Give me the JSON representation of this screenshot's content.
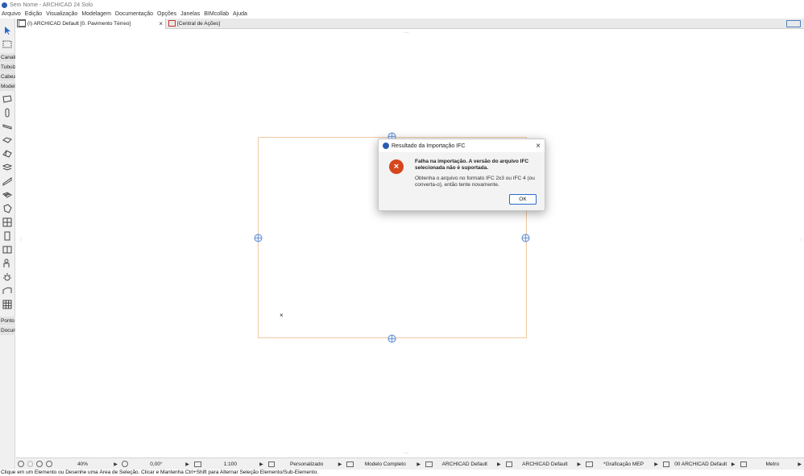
{
  "window": {
    "title": "Sem Nome - ARCHICAD 24 Solo"
  },
  "menu": [
    "Arquivo",
    "Edição",
    "Visualização",
    "Modelagem",
    "Documentação",
    "Opções",
    "Janelas",
    "BIMcollab",
    "Ajuda"
  ],
  "tabs": [
    {
      "label": "(I) ARCHICAD Default [0. Pavimento Térreo]",
      "close": "×"
    },
    {
      "label": "[Central de Ações]"
    }
  ],
  "toolbox": {
    "labels": [
      "Canali",
      "Tubulz",
      "Cabea",
      "Model",
      "Ponto",
      "Docun"
    ]
  },
  "dialog": {
    "title": "Resultado da Importação IFC",
    "heading": "Falha na importação. A versão do arquivo IFC selecionada não é suportada.",
    "body": "Obtenha o arquivo no formato IFC 2x3 ou IFC 4 (ou converta-o), então tente novamente.",
    "ok_label": "OK",
    "close": "×",
    "error_glyph": "×"
  },
  "canvas": {
    "marker": "×"
  },
  "statusbar": {
    "zoom": "40%",
    "angle": "0,00°",
    "scale": "1:100",
    "layer_combo": "Personalizado",
    "model_view": "Modelo Completo",
    "pen_set": "ARCHICAD Default",
    "renovation": "ARCHICAD Default",
    "graphic_override": "*Graficação MEP",
    "dimension": "00 ARCHICAD Default",
    "units": "Metro"
  },
  "hint": "Clique em um Elemento ou Desenhe uma Área de Seleção. Clicar e Mantenha Ctrl+Shift para Alternar Seleção Elemento/Sub-Elemento."
}
